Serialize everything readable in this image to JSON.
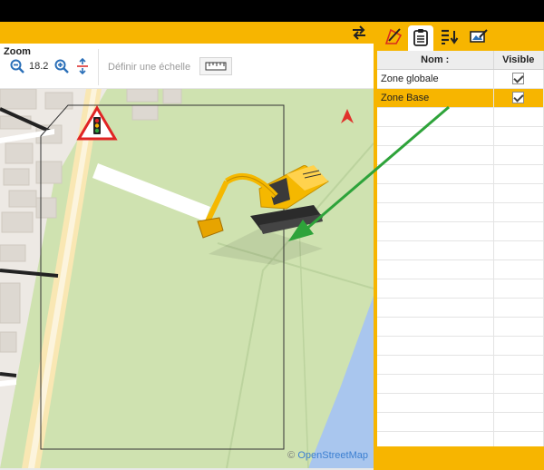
{
  "toolbar": {
    "zoom_title": "Zoom",
    "zoom_value": "18.2",
    "scale_placeholder": "Définir une échelle"
  },
  "map": {
    "attribution_symbol": "©",
    "attribution_text": "OpenStreetMap"
  },
  "layers_table": {
    "columns": [
      "Nom :",
      "Visible"
    ],
    "rows": [
      {
        "name": "Zone globale",
        "visible": true,
        "selected": false
      },
      {
        "name": "Zone Base",
        "visible": true,
        "selected": true
      }
    ]
  },
  "colors": {
    "accent": "#f7b500",
    "map_park": "#cfe2b0",
    "map_water": "#a9c6ee",
    "arrow": "#2ea33a"
  },
  "icons": {
    "swap": "swap-arrows-icon",
    "zoom_out": "zoom-out-icon",
    "zoom_in": "zoom-in-icon",
    "fit": "fit-vertical-icon",
    "scale": "ruler-icon",
    "compass": "north-arrow-icon",
    "traffic": "traffic-light-sign-icon",
    "machine": "excavator-icon"
  }
}
